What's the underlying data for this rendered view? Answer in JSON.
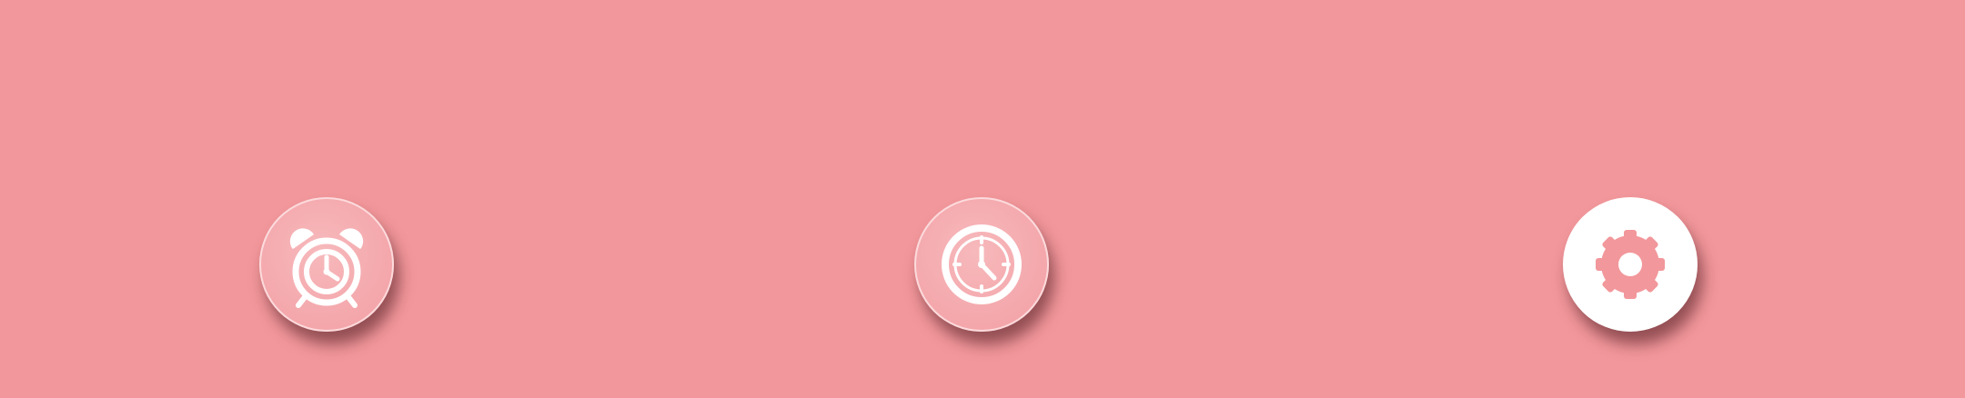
{
  "app": {
    "background_color": "#f2979b",
    "icon_color": "#ffffff",
    "active_button_color": "#ffffff",
    "active_icon_color": "#f2979b"
  },
  "nav_buttons": [
    {
      "icon": "alarm-clock-icon",
      "active": false
    },
    {
      "icon": "clock-icon",
      "active": false
    },
    {
      "icon": "gear-icon",
      "active": true
    }
  ]
}
